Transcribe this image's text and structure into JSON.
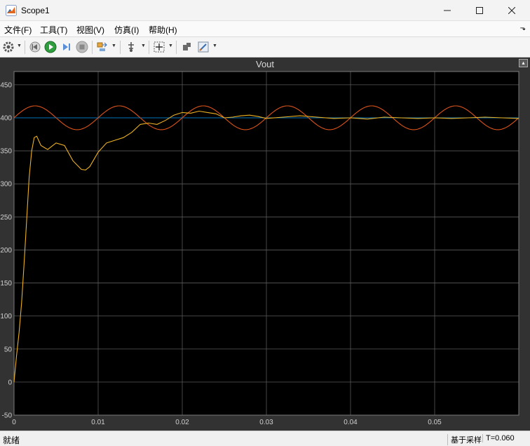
{
  "window": {
    "title": "Scope1"
  },
  "menu": [
    "文件(F)",
    "工具(T)",
    "视图(V)",
    "仿真(I)",
    "帮助(H)"
  ],
  "plot": {
    "title": "Vout"
  },
  "status": {
    "left": "就绪",
    "mode": "基于采样",
    "time": "T=0.060"
  },
  "colors": {
    "background": "#000000",
    "grid": "#595959",
    "frame": "#323232",
    "series1": "#0072BD",
    "series2": "#D95319",
    "series3": "#EDB120"
  },
  "chart_data": {
    "type": "line",
    "title": "Vout",
    "xlim": [
      0,
      0.06
    ],
    "ylim": [
      -50,
      470
    ],
    "xticks": [
      0,
      0.01,
      0.02,
      0.03,
      0.04,
      0.05
    ],
    "xtick_labels": [
      "0",
      "0.01",
      "0.02",
      "0.03",
      "0.04",
      "0.05"
    ],
    "yticks": [
      -50,
      0,
      50,
      100,
      150,
      200,
      250,
      300,
      350,
      400,
      450
    ],
    "ytick_labels": [
      "-50",
      "0",
      "50",
      "100",
      "150",
      "200",
      "250",
      "300",
      "350",
      "400",
      "450"
    ],
    "grid": true,
    "series": [
      {
        "color": "#0072BD",
        "x": [
          0,
          0.06
        ],
        "y": [
          400,
          400
        ]
      },
      {
        "color": "#D95319",
        "x": [
          0,
          0.0025,
          0.005,
          0.0075,
          0.01,
          0.0125,
          0.015,
          0.0175,
          0.02,
          0.0225,
          0.025,
          0.0275,
          0.03,
          0.0325,
          0.035,
          0.0375,
          0.04,
          0.0425,
          0.045,
          0.0475,
          0.05,
          0.0525,
          0.055,
          0.0575,
          0.06
        ],
        "y": [
          400,
          418,
          400,
          382,
          400,
          418,
          400,
          382,
          400,
          418,
          400,
          382,
          400,
          418,
          400,
          382,
          400,
          418,
          400,
          382,
          400,
          418,
          400,
          382,
          400
        ]
      },
      {
        "color": "#EDB120",
        "x": [
          0,
          0.0003,
          0.0006,
          0.0009,
          0.0012,
          0.0015,
          0.0018,
          0.0021,
          0.0024,
          0.0027,
          0.0032,
          0.004,
          0.005,
          0.006,
          0.007,
          0.008,
          0.0085,
          0.009,
          0.01,
          0.011,
          0.012,
          0.013,
          0.014,
          0.015,
          0.016,
          0.017,
          0.018,
          0.019,
          0.02,
          0.021,
          0.022,
          0.023,
          0.024,
          0.025,
          0.026,
          0.027,
          0.028,
          0.029,
          0.03,
          0.032,
          0.034,
          0.036,
          0.038,
          0.04,
          0.042,
          0.044,
          0.046,
          0.048,
          0.05,
          0.052,
          0.054,
          0.056,
          0.058,
          0.06
        ],
        "y": [
          0,
          40,
          75,
          120,
          180,
          245,
          310,
          350,
          370,
          372,
          358,
          352,
          362,
          358,
          335,
          322,
          321,
          326,
          348,
          362,
          366,
          370,
          378,
          390,
          392,
          390,
          396,
          404,
          408,
          407,
          410,
          408,
          406,
          400,
          401,
          403,
          404,
          402,
          399,
          401,
          403,
          401,
          399,
          400,
          398,
          401,
          400,
          399,
          400,
          399,
          400,
          401,
          400,
          399
        ]
      }
    ]
  }
}
